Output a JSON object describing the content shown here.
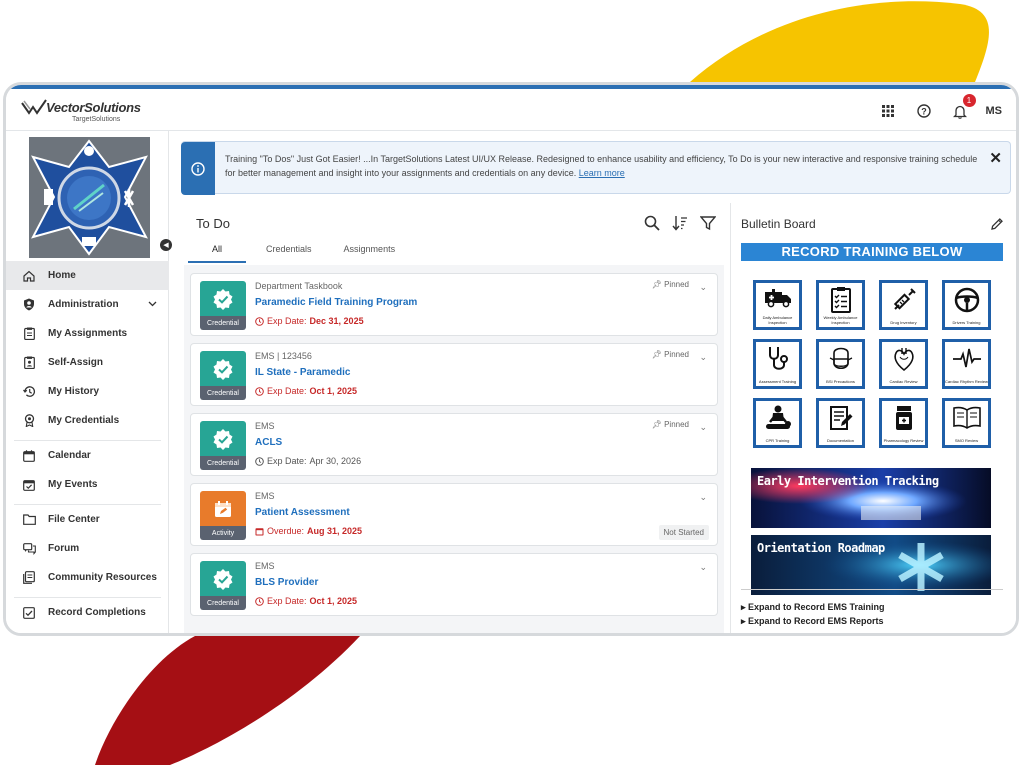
{
  "brand": {
    "name": "VectorSolutions",
    "sub": "TargetSolutions"
  },
  "header": {
    "notifications_count": "1",
    "user_initials": "MS"
  },
  "sidebar": {
    "items": [
      {
        "label": "Home",
        "icon": "home-icon",
        "active": true
      },
      {
        "label": "Administration",
        "icon": "shield-user-icon",
        "expandable": true
      },
      {
        "label": "My Assignments",
        "icon": "clipboard-icon"
      },
      {
        "label": "Self-Assign",
        "icon": "clipboard-user-icon"
      },
      {
        "label": "My History",
        "icon": "history-icon"
      },
      {
        "label": "My Credentials",
        "icon": "award-icon"
      },
      {
        "label": "Calendar",
        "icon": "calendar-icon"
      },
      {
        "label": "My Events",
        "icon": "calendar-check-icon"
      },
      {
        "label": "File Center",
        "icon": "folder-icon"
      },
      {
        "label": "Forum",
        "icon": "forum-icon"
      },
      {
        "label": "Community Resources",
        "icon": "resources-icon"
      },
      {
        "label": "Record Completions",
        "icon": "record-icon"
      }
    ]
  },
  "banner": {
    "text": "Training \"To Dos\" Just Got Easier! ...In TargetSolutions Latest UI/UX Release. Redesigned to enhance usability and efficiency, To Do is your new interactive and responsive training schedule for better management and insight into your assignments and credentials on any device.",
    "link": "Learn more"
  },
  "todo": {
    "title": "To Do",
    "tabs": [
      "All",
      "Credentials",
      "Assignments"
    ],
    "cards": [
      {
        "type_label": "Credential",
        "category": "Department Taskbook",
        "title": "Paramedic Field Training Program",
        "date_prefix": "Exp Date:",
        "date_value": "Dec 31,  2025",
        "date_style": "red",
        "pinned": "Pinned",
        "status": "",
        "color": "#27a595"
      },
      {
        "type_label": "Credential",
        "category": "EMS | 123456",
        "title": "IL State - Paramedic",
        "date_prefix": "Exp Date:",
        "date_value": "Oct 1, 2025",
        "date_style": "red",
        "pinned": "Pinned",
        "status": "",
        "color": "#27a595"
      },
      {
        "type_label": "Credential",
        "category": "EMS",
        "title": "ACLS",
        "date_prefix": "Exp Date:",
        "date_value": "Apr 30, 2026",
        "date_style": "gray",
        "pinned": "Pinned",
        "status": "",
        "color": "#27a595"
      },
      {
        "type_label": "Activity",
        "category": "EMS",
        "title": "Patient Assessment",
        "date_prefix": "Overdue:",
        "date_value": "Aug 31,  2025",
        "date_style": "red",
        "pinned": "",
        "status": "Not Started",
        "color": "#e87b2b"
      },
      {
        "type_label": "Credential",
        "category": "EMS",
        "title": "BLS Provider",
        "date_prefix": "Exp Date:",
        "date_value": "Oct 1, 2025",
        "date_style": "red",
        "pinned": "",
        "status": "",
        "color": "#27a595"
      }
    ]
  },
  "bulletin": {
    "title": "Bulletin Board",
    "record_header": "RECORD TRAINING BELOW",
    "tiles": [
      {
        "label": "Daily Ambulance Inspection",
        "icon": "ambulance-icon"
      },
      {
        "label": "Weekly Ambulance Inspection",
        "icon": "checklist-icon"
      },
      {
        "label": "Drug Inventory",
        "icon": "syringe-icon"
      },
      {
        "label": "Drivers Training",
        "icon": "steering-wheel-icon"
      },
      {
        "label": "Assessment Training",
        "icon": "stethoscope-icon"
      },
      {
        "label": "BSI Precautions",
        "icon": "mask-icon"
      },
      {
        "label": "Cardiac Review",
        "icon": "heart-icon"
      },
      {
        "label": "Cardiac Rhythm Review",
        "icon": "ekg-icon"
      },
      {
        "label": "CPR Training",
        "icon": "cpr-icon"
      },
      {
        "label": "Documentation",
        "icon": "document-pen-icon"
      },
      {
        "label": "Pharmacology Review",
        "icon": "pill-bottle-icon"
      },
      {
        "label": "SMO Review",
        "icon": "book-icon"
      }
    ],
    "promo1": "Early Intervention Tracking",
    "promo2": "Orientation Roadmap",
    "expand1": "▸ Expand to Record EMS Training",
    "expand2": "▸ Expand to Record EMS Reports"
  },
  "colors": {
    "primary": "#2b6fb3",
    "credential": "#27a595",
    "activity": "#e87b2b",
    "overdue": "#c62828",
    "accent_yellow": "#f6c400",
    "accent_red": "#a50f14"
  }
}
